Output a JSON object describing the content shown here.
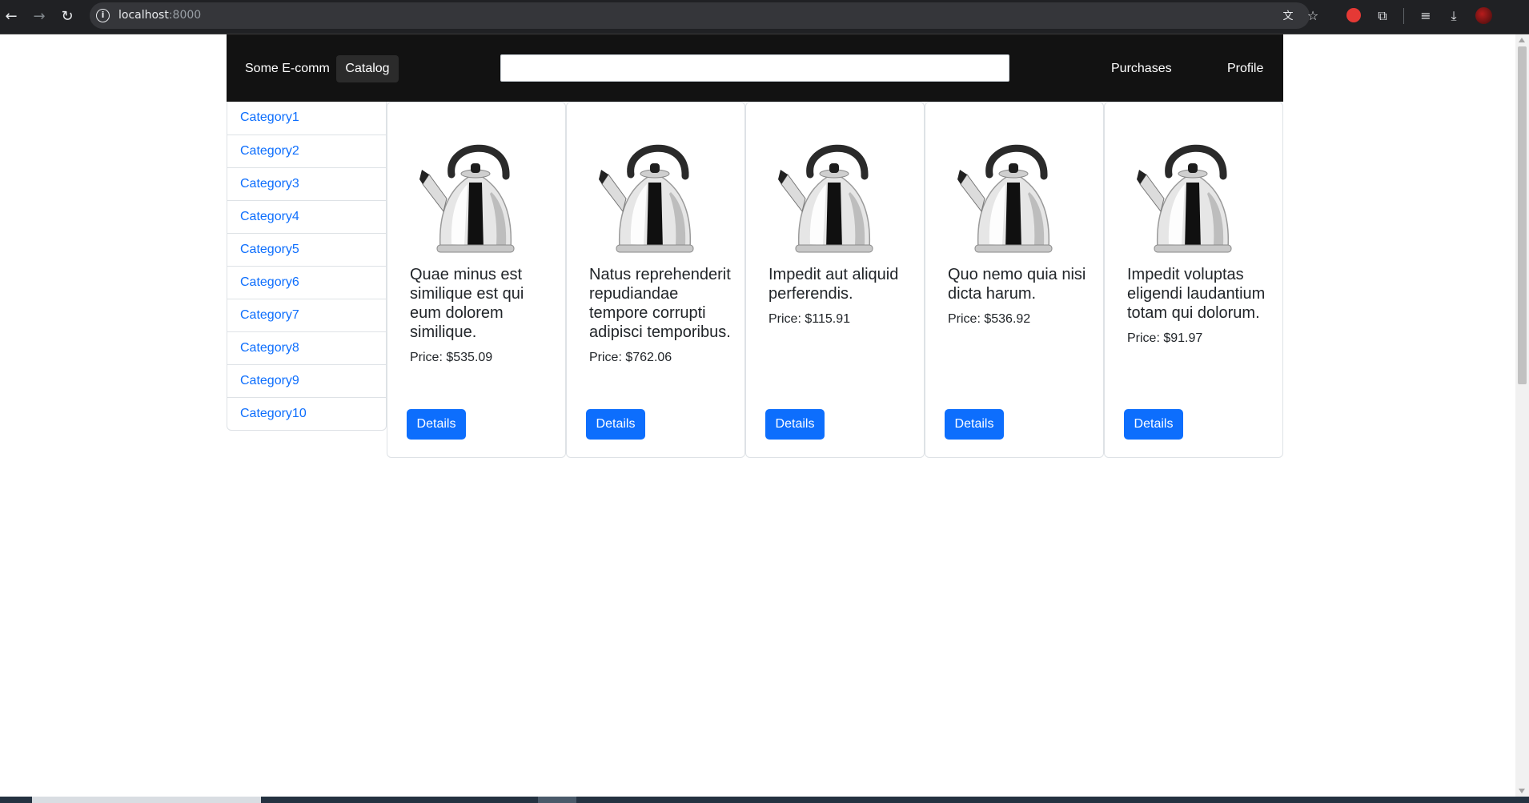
{
  "browser": {
    "url_host": "localhost",
    "url_port": ":8000",
    "icons": [
      "back-arrow-icon",
      "forward-arrow-icon",
      "reload-icon",
      "site-info-icon",
      "translate-icon",
      "bookmark-star-icon",
      "extension-icon",
      "puzzle-extensions-icon",
      "media-queue-icon",
      "download-icon",
      "profile-avatar-icon"
    ]
  },
  "navbar": {
    "brand": "Some E-comm",
    "catalog_label": "Catalog",
    "search_value": "",
    "purchases_label": "Purchases",
    "profile_label": "Profile"
  },
  "sidebar": {
    "categories": [
      {
        "label": "Category1"
      },
      {
        "label": "Category2"
      },
      {
        "label": "Category3"
      },
      {
        "label": "Category4"
      },
      {
        "label": "Category5"
      },
      {
        "label": "Category6"
      },
      {
        "label": "Category7"
      },
      {
        "label": "Category8"
      },
      {
        "label": "Category9"
      },
      {
        "label": "Category10"
      }
    ]
  },
  "products": [
    {
      "title": "Quae minus est similique est qui eum dolorem similique.",
      "price": "Price: $535.09",
      "button": "Details",
      "image": "kettle-image"
    },
    {
      "title": "Natus reprehenderit repudiandae tempore corrupti adipisci temporibus.",
      "price": "Price: $762.06",
      "button": "Details",
      "image": "kettle-image"
    },
    {
      "title": "Impedit aut aliquid perferendis.",
      "price": "Price: $115.91",
      "button": "Details",
      "image": "kettle-image"
    },
    {
      "title": "Quo nemo quia nisi dicta harum.",
      "price": "Price: $536.92",
      "button": "Details",
      "image": "kettle-image"
    },
    {
      "title": "Impedit voluptas eligendi laudantium totam qui dolorum.",
      "price": "Price: $91.97",
      "button": "Details",
      "image": "kettle-image"
    }
  ],
  "colors": {
    "navbar_bg": "#121212",
    "link": "#0d6efd",
    "button": "#0d6efd"
  }
}
